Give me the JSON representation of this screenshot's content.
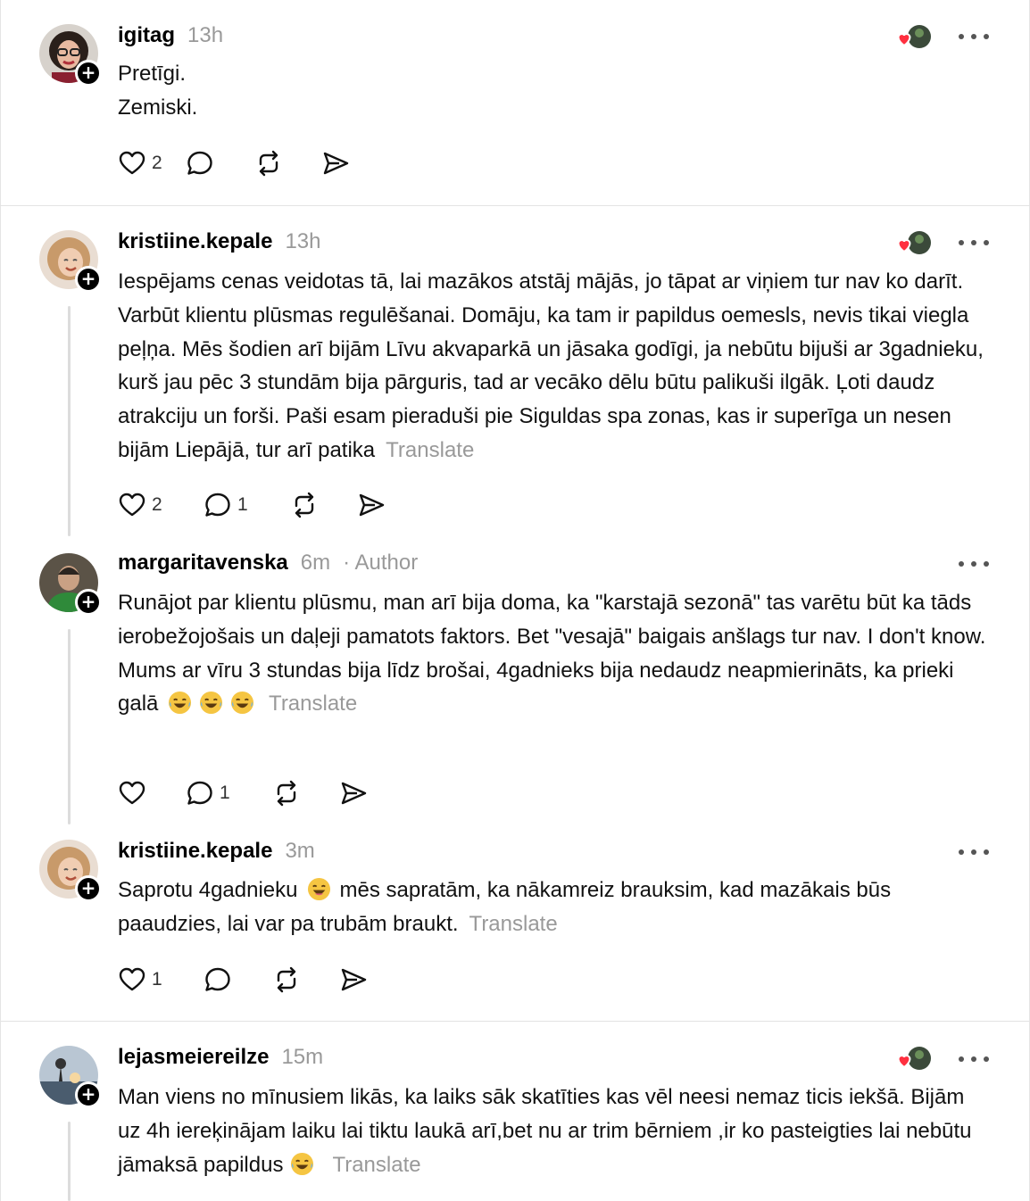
{
  "ui": {
    "translate_label": "Translate",
    "author_label": "Author",
    "author_sep": "·"
  },
  "posts": [
    {
      "username": "igitag",
      "time": "13h",
      "lines": [
        "Pretīgi.",
        "Zemiski."
      ],
      "likes": "2",
      "replies": "",
      "avatar_icon": "woman-glasses-avatar"
    },
    {
      "username": "kristiine.kepale",
      "time": "13h",
      "text": "Iespējams cenas veidotas tā, lai mazākos atstāj mājās, jo tāpat ar viņiem tur nav ko darīt. Varbūt klientu plūsmas regulēšanai. Domāju, ka tam ir papildus oemesls, nevis tikai viegla peļņa. Mēs šodien arī bijām Līvu akvaparkā un jāsaka godīgi, ja nebūtu bijuši ar 3gadnieku, kurš jau pēc 3 stundām bija pārguris, tad ar vecāko dēlu būtu palikuši ilgāk. Ļoti daudz atrakciju un forši. Paši esam pieraduši pie Siguldas spa zonas, kas ir superīga un nesen bijām Liepājā, tur arī patika",
      "likes": "2",
      "replies": "1",
      "avatar_icon": "smiling-woman-avatar"
    },
    {
      "username": "margaritavenska",
      "time": "6m",
      "text_a": "Runājot par klientu plūsmu, man arī bija doma, ka \"karstajā sezonā\" tas varētu būt ka tāds ierobežojošais un daļeji pamatots faktors. Bet \"vesajā\" baigais anšlags tur nav. I don't know.",
      "text_b": "Mums ar vīru 3 stundas bija līdz brošai, 4gadnieks bija nedaudz neapmierināts, ka prieki galā",
      "likes": "",
      "replies": "1",
      "avatar_icon": "person-green-shirt-avatar"
    },
    {
      "username": "kristiine.kepale",
      "time": "3m",
      "text_a": "Saprotu 4gadnieku",
      "text_b": "mēs sapratām, ka nākamreiz brauksim, kad mazākais būs paaudzies, lai var pa trubām braukt.",
      "likes": "1",
      "replies": "",
      "avatar_icon": "smiling-woman-avatar"
    },
    {
      "username": "lejasmeiereilze",
      "time": "15m",
      "text": "Man viens no mīnusiem likās, ka laiks sāk skatīties kas vēl neesi nemaz ticis iekšā. Bijām uz 4h iereķinājam laiku lai tiktu laukā arī,bet nu ar trim bērniem ,ir ko pasteigties lai nebūtu jāmaksā papildus",
      "avatar_icon": "sunset-landscape-avatar"
    }
  ],
  "colors": {
    "muted": "#999999",
    "divider": "#e3e3e3",
    "heart": "#ff3040"
  }
}
